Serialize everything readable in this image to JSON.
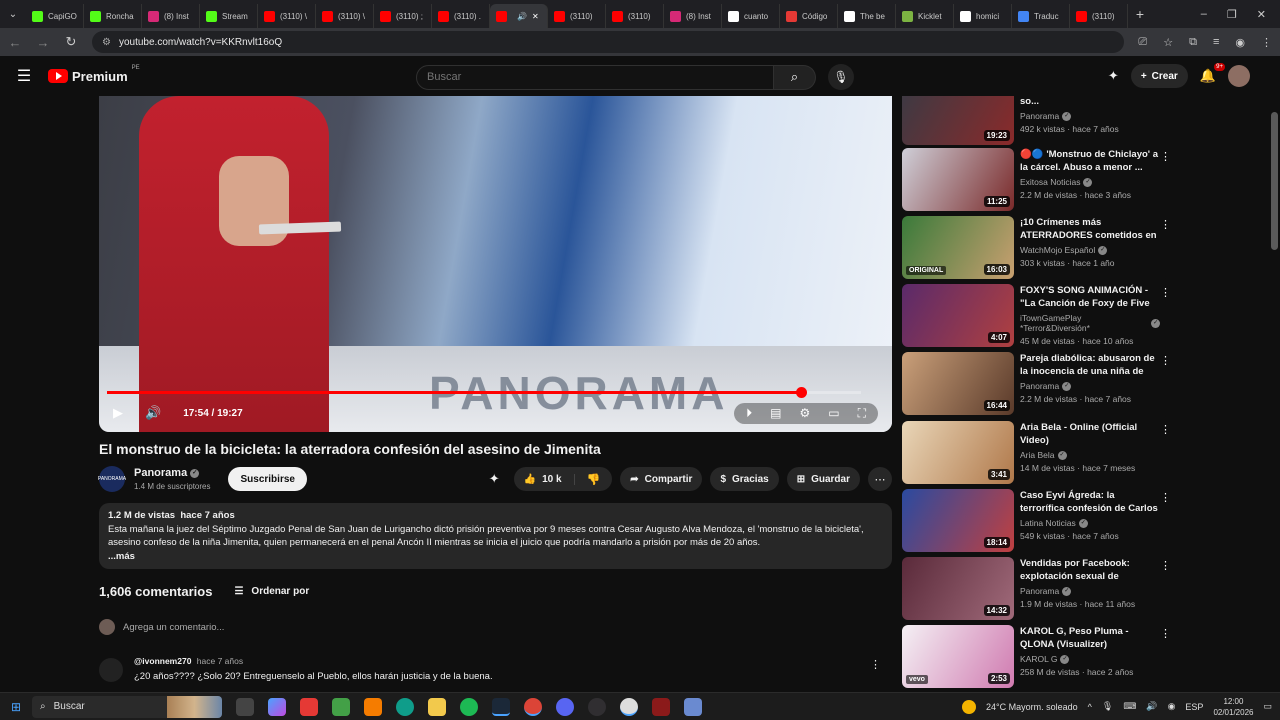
{
  "browser": {
    "tabs": [
      {
        "label": "CapiGO",
        "icon": "k-icon",
        "color": "#53fc18"
      },
      {
        "label": "Roncha",
        "icon": "k-icon",
        "color": "#53fc18"
      },
      {
        "label": "(8) Inst",
        "icon": "instagram-icon",
        "color": "#d62976"
      },
      {
        "label": "Stream",
        "icon": "k-icon",
        "color": "#53fc18"
      },
      {
        "label": "(3110) \\",
        "icon": "youtube-icon",
        "color": "#ff0000"
      },
      {
        "label": "(3110) \\",
        "icon": "youtube-icon",
        "color": "#ff0000"
      },
      {
        "label": "(3110) ;",
        "icon": "youtube-icon",
        "color": "#ff0000"
      },
      {
        "label": "(3110) .",
        "icon": "youtube-icon",
        "color": "#ff0000"
      },
      {
        "label": "",
        "icon": "youtube-icon",
        "color": "#ff0000",
        "active": true
      },
      {
        "label": "(3110)",
        "icon": "youtube-icon",
        "color": "#ff0000"
      },
      {
        "label": "(3110)",
        "icon": "youtube-icon",
        "color": "#ff0000"
      },
      {
        "label": "(8) Inst",
        "icon": "instagram-icon",
        "color": "#d62976"
      },
      {
        "label": "cuanto",
        "icon": "google-icon",
        "color": "#ffffff"
      },
      {
        "label": "Código",
        "icon": "code-icon",
        "color": "#e53935"
      },
      {
        "label": "The be",
        "icon": "diamond-icon",
        "color": "#ffffff"
      },
      {
        "label": "Kicklet",
        "icon": "kicklet-icon",
        "color": "#7cb342"
      },
      {
        "label": "homici",
        "icon": "google-icon",
        "color": "#ffffff"
      },
      {
        "label": "Traduc",
        "icon": "translate-icon",
        "color": "#4285f4"
      },
      {
        "label": "(3110)",
        "icon": "youtube-icon",
        "color": "#ff0000"
      }
    ],
    "url": "youtube.com/watch?v=KKRnvlt16oQ"
  },
  "header": {
    "logo_text": "Premium",
    "logo_region": "PE",
    "search_placeholder": "Buscar",
    "create_label": "Crear",
    "notifications_badge": "9+"
  },
  "player": {
    "time": "17:54 / 19:27",
    "progress": 0.92,
    "watermark": "PANORAMA"
  },
  "video": {
    "title": "El monstruo de la bicicleta: la aterradora confesión del asesino de Jimenita",
    "channel": "Panorama",
    "channel_avatar_text": "PANORAMA",
    "subscribers": "1.4 M de suscriptores",
    "subscribe_label": "Suscribirse",
    "likes": "10 k",
    "share_label": "Compartir",
    "thanks_label": "Gracias",
    "save_label": "Guardar",
    "views": "1.2 M de vistas",
    "age": "hace 7 años",
    "description": "Esta mañana la juez del Séptimo Juzgado Penal de San Juan de Lurigancho dictó prisión preventiva por 9 meses contra Cesar Augusto Alva Mendoza, el 'monstruo de la bicicleta', asesino confeso de la niña Jimenita, quien permanecerá en el penal Ancón II mientras se inicia el juicio que podría mandarlo a prisión por más de 20 años.",
    "more_label": "...más"
  },
  "comments": {
    "count_label": "1,606 comentarios",
    "sort_label": "Ordenar por",
    "add_placeholder": "Agrega un comentario...",
    "items": [
      {
        "author": "@ivonnem270",
        "time": "hace 7 años",
        "text": "¿20 años???? ¿Solo 20? Entreguenselo al Pueblo, ellos harán justicia y de la buena."
      }
    ]
  },
  "recommendations": [
    {
      "title": "asesinos de Eyvi y Jimenita so...",
      "channel": "Panorama",
      "meta": "492 k vistas · hace 7 años",
      "duration": "19:23",
      "thumb_colors": [
        "#3a3a44",
        "#8a2a2a"
      ],
      "badge": "",
      "prefix": ""
    },
    {
      "title": "'Monstruo de Chiclayo' a la cárcel. Abuso a menor ...",
      "channel": "Exitosa Noticias",
      "meta": "2.2 M de vistas · hace 3 años",
      "duration": "11:25",
      "thumb_colors": [
        "#cfcfd8",
        "#7a2a2a"
      ],
      "badge": "",
      "prefix": "🔴🔵"
    },
    {
      "title": "¡10 Crímenes más ATERRADORES cometidos en ...",
      "channel": "WatchMojo Español",
      "meta": "303 k vistas · hace 1 año",
      "duration": "16:03",
      "thumb_colors": [
        "#3a7a3a",
        "#c9a070"
      ],
      "badge": "ORIGINAL",
      "prefix": ""
    },
    {
      "title": "FOXY'S SONG ANIMACIÓN - \"La Canción de Foxy de Five Night...",
      "channel": "iTownGamePlay *Terror&Diversión*",
      "meta": "45 M de vistas · hace 10 años",
      "duration": "4:07",
      "thumb_colors": [
        "#5a2a6a",
        "#b04040"
      ],
      "badge": "",
      "prefix": ""
    },
    {
      "title": "Pareja diabólica: abusaron de la inocencia de una niña de solo ...",
      "channel": "Panorama",
      "meta": "2.2 M de vistas · hace 7 años",
      "duration": "16:44",
      "thumb_colors": [
        "#caa07a",
        "#5a3a2a"
      ],
      "badge": "",
      "prefix": ""
    },
    {
      "title": "Aria Bela - Online (Official Video)",
      "channel": "Aria Bela",
      "meta": "14 M de vistas · hace 7 meses",
      "duration": "3:41",
      "thumb_colors": [
        "#e9d6b8",
        "#b0784a"
      ],
      "badge": "",
      "prefix": ""
    },
    {
      "title": "Caso Eyvi Ágreda: la terrorífica confesión de Carlos Hualpa",
      "channel": "Latina Noticias",
      "meta": "549 k vistas · hace 7 años",
      "duration": "18:14",
      "thumb_colors": [
        "#2a4aa0",
        "#c04040"
      ],
      "badge": "",
      "prefix": ""
    },
    {
      "title": "Vendidas por Facebook: explotación sexual de menore...",
      "channel": "Panorama",
      "meta": "1.9 M de vistas · hace 11 años",
      "duration": "14:32",
      "thumb_colors": [
        "#5a2a3a",
        "#a06a7a"
      ],
      "badge": "",
      "prefix": ""
    },
    {
      "title": "KAROL G, Peso Pluma - QLONA (Visualizer)",
      "channel": "KAROL G",
      "meta": "258 M de vistas · hace 2 años",
      "duration": "2:53",
      "thumb_colors": [
        "#f4f0f4",
        "#d07ab0"
      ],
      "badge": "vevo",
      "prefix": ""
    }
  ],
  "taskbar": {
    "search_label": "Buscar",
    "weather": "24°C  Mayorm. soleado",
    "lang": "ESP",
    "time": "12:00",
    "date": "02/01/2026"
  }
}
